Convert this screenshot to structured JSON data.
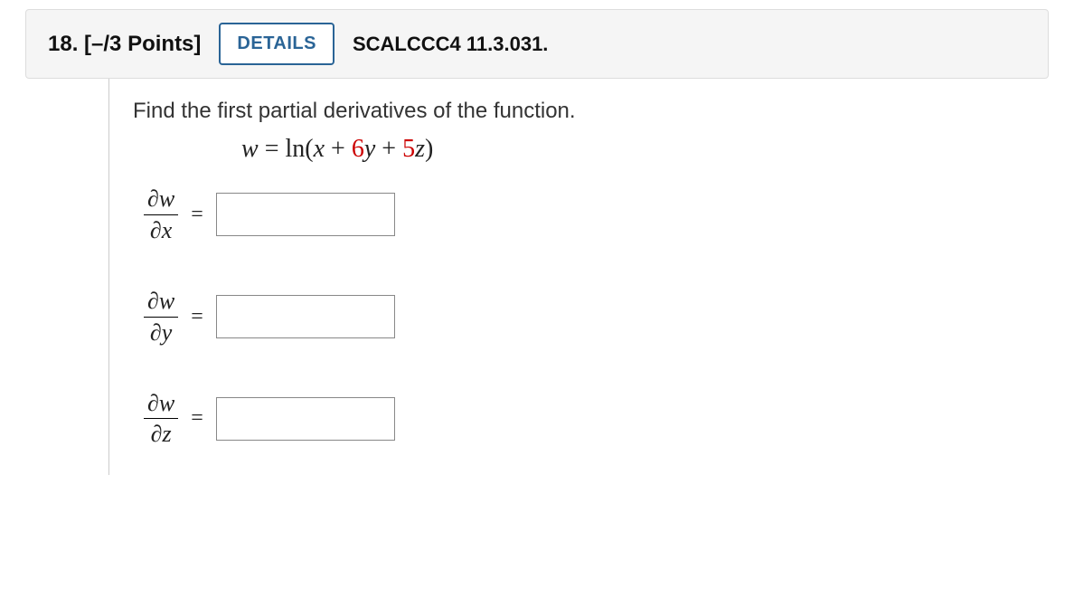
{
  "header": {
    "number": "18.",
    "points": "[–/3 Points]",
    "details_label": "DETAILS",
    "source": "SCALCCC4 11.3.031."
  },
  "question": {
    "prompt": "Find the first partial derivatives of the function.",
    "equation_w": "w",
    "equation_eq": " = ",
    "equation_ln": "ln",
    "equation_open": "(",
    "equation_x": "x",
    "equation_plus1": " + ",
    "equation_six": "6",
    "equation_y": "y",
    "equation_plus2": " + ",
    "equation_five": "5",
    "equation_z": "z",
    "equation_close": ")"
  },
  "rows": {
    "dx": {
      "num": "∂w",
      "den": "∂x",
      "eq": "=",
      "value": ""
    },
    "dy": {
      "num": "∂w",
      "den": "∂y",
      "eq": "=",
      "value": ""
    },
    "dz": {
      "num": "∂w",
      "den": "∂z",
      "eq": "=",
      "value": ""
    }
  }
}
